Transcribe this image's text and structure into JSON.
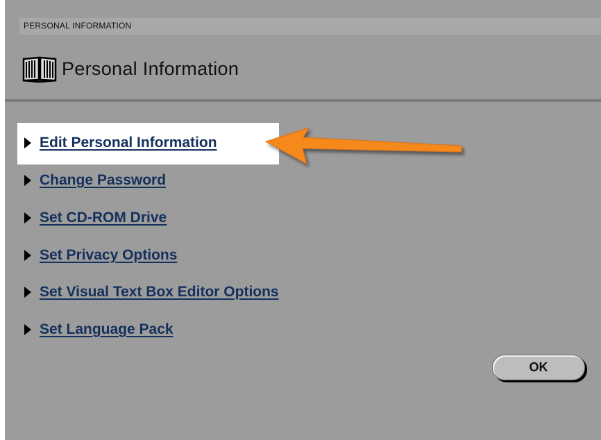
{
  "breadcrumb": {
    "text": "PERSONAL INFORMATION"
  },
  "header": {
    "title": "Personal Information",
    "icon": "book-icon"
  },
  "menu": {
    "items": [
      {
        "label": "Edit Personal Information",
        "highlighted": true
      },
      {
        "label": "Change Password"
      },
      {
        "label": "Set CD-ROM Drive"
      },
      {
        "label": "Set Privacy Options"
      },
      {
        "label": "Set Visual Text Box Editor Options"
      },
      {
        "label": "Set Language Pack"
      }
    ]
  },
  "actions": {
    "ok_label": "OK"
  },
  "annotation": {
    "arrow_icon": "callout-arrow-icon",
    "arrow_color": "#f5891f"
  },
  "colors": {
    "background": "#9c9c9c",
    "link": "#14305c",
    "divider": "#7b7b7b"
  }
}
